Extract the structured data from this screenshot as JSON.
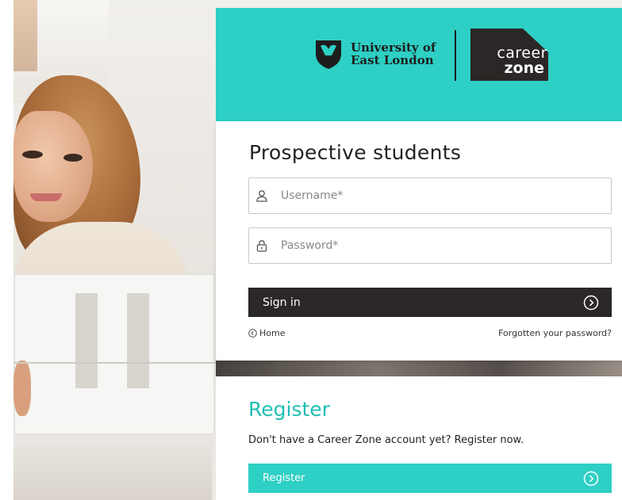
{
  "brand": {
    "university_line1": "University of",
    "university_line2": "East London",
    "careerzone_line1": "career",
    "careerzone_line2": "zone",
    "accent": "#2ecfc4",
    "dark": "#2a2726"
  },
  "login": {
    "title": "Prospective students",
    "username_placeholder": "Username*",
    "username_icon": "user-icon",
    "password_placeholder": "Password*",
    "password_icon": "lock-icon",
    "signin_label": "Sign in",
    "home_label": "Home",
    "forgot_label": "Forgotten your password?"
  },
  "register": {
    "title": "Register",
    "text": "Don't have a Career Zone account yet? Register now.",
    "button_label": "Register"
  }
}
